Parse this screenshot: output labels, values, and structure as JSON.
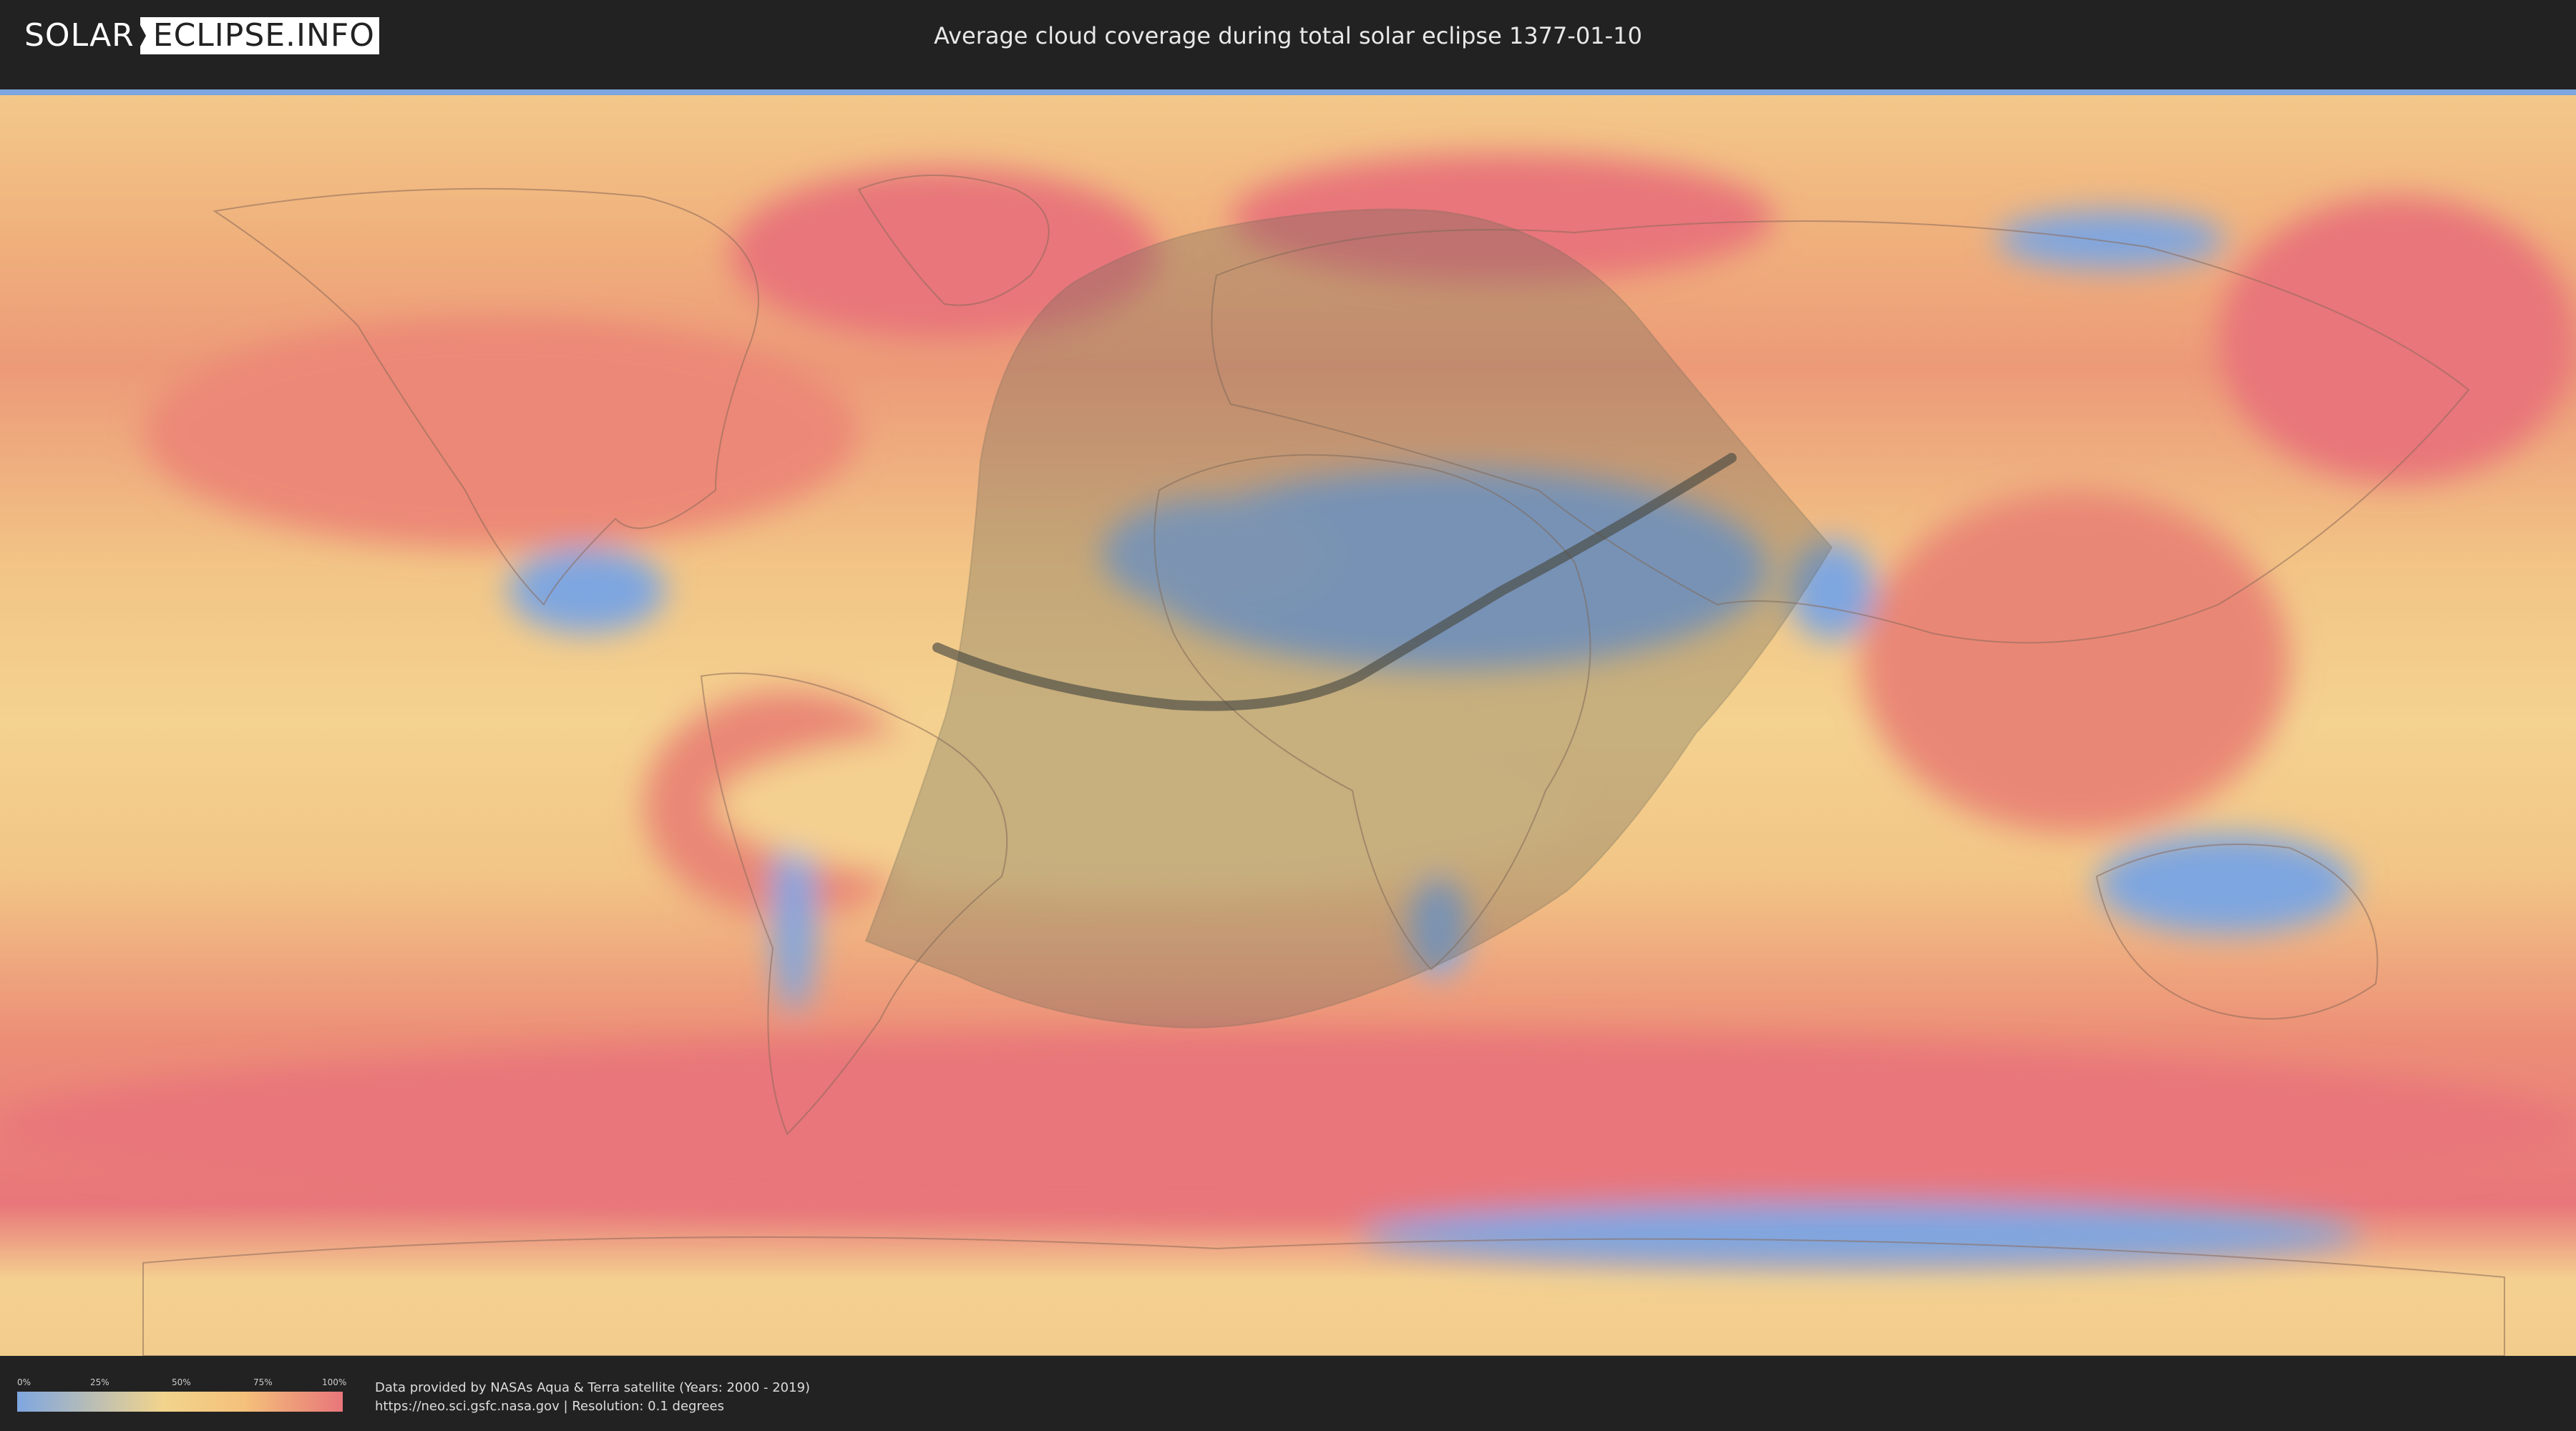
{
  "header": {
    "logo_left": "SOLAR",
    "logo_right": "ECLIPSE.INFO",
    "title": "Average cloud coverage during total solar eclipse 1377-01-10"
  },
  "legend": {
    "ticks": [
      "0%",
      "25%",
      "50%",
      "75%",
      "100%"
    ],
    "colors": [
      "#7ea6e0",
      "#f2d48c",
      "#f4c07a",
      "#e8767a"
    ]
  },
  "credits": {
    "line1": "Data provided by NASAs Aqua & Terra satellite (Years: 2000 - 2019)",
    "line2": "https://neo.sci.gsfc.nasa.gov | Resolution: 0.1 degrees"
  },
  "map": {
    "ocean_color": "#ea8a6f",
    "high_cloud_color": "#e8767a",
    "low_cloud_color": "#7ea6e0",
    "mid_cloud_color": "#f4d08a",
    "shadow_color": "#6b6b5a",
    "central_line_color": "#4a4a42"
  }
}
